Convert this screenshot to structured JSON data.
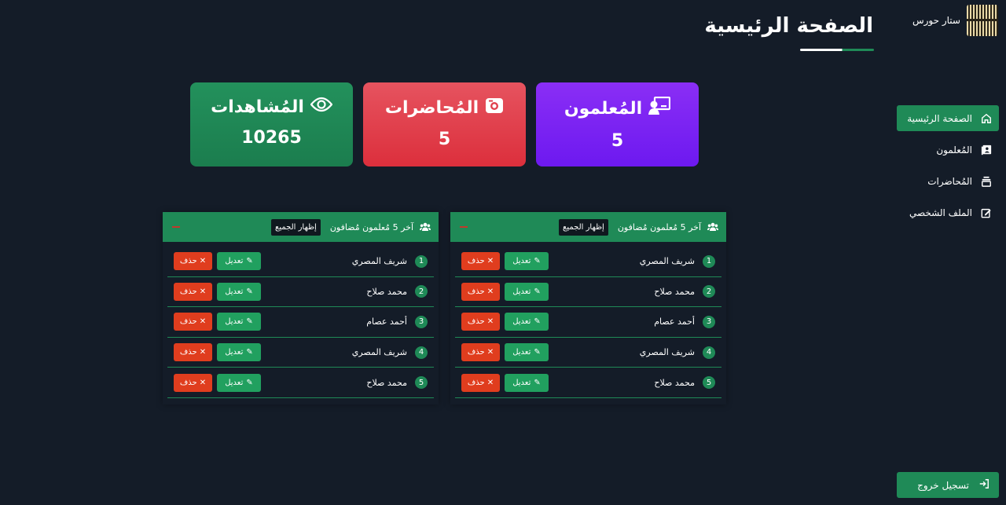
{
  "brand": {
    "name": "ستار حورس"
  },
  "sidebar": {
    "items": [
      {
        "label": "الصفحة الرئيسية",
        "icon": "home-icon",
        "active": true
      },
      {
        "label": "المُعلمون",
        "icon": "teacher-book-icon",
        "active": false
      },
      {
        "label": "المُحاضرات",
        "icon": "stack-icon",
        "active": false
      },
      {
        "label": "الملف الشخصي",
        "icon": "edit-profile-icon",
        "active": false
      }
    ],
    "logout_label": "تسجيل خروج"
  },
  "header": {
    "title": "الصفحة الرئيسية"
  },
  "stats": {
    "teachers": {
      "label": "المُعلمون",
      "value": "5",
      "color": "#7b22f3"
    },
    "lectures": {
      "label": "المُحاضرات",
      "value": "5",
      "color": "#e1414d"
    },
    "views": {
      "label": "المُشاهدات",
      "value": "10265",
      "color": "#1f8a57"
    }
  },
  "tables": {
    "right": {
      "title": "آخر 5 مُعلمون مُضافون",
      "show_all": "إظهار الجميع",
      "rows": [
        {
          "num": "1",
          "name": "شريف المصري"
        },
        {
          "num": "2",
          "name": "محمد صلاح"
        },
        {
          "num": "3",
          "name": "أحمد عصام"
        },
        {
          "num": "4",
          "name": "شريف المصري"
        },
        {
          "num": "5",
          "name": "محمد صلاح"
        }
      ]
    },
    "left": {
      "title": "آخر 5 مُعلمون مُضافون",
      "show_all": "إظهار الجميع",
      "rows": [
        {
          "num": "1",
          "name": "شريف المصري"
        },
        {
          "num": "2",
          "name": "محمد صلاح"
        },
        {
          "num": "3",
          "name": "أحمد عصام"
        },
        {
          "num": "4",
          "name": "شريف المصري"
        },
        {
          "num": "5",
          "name": "محمد صلاح"
        }
      ]
    },
    "edit_label": "تعديل",
    "delete_label": "حذف"
  }
}
